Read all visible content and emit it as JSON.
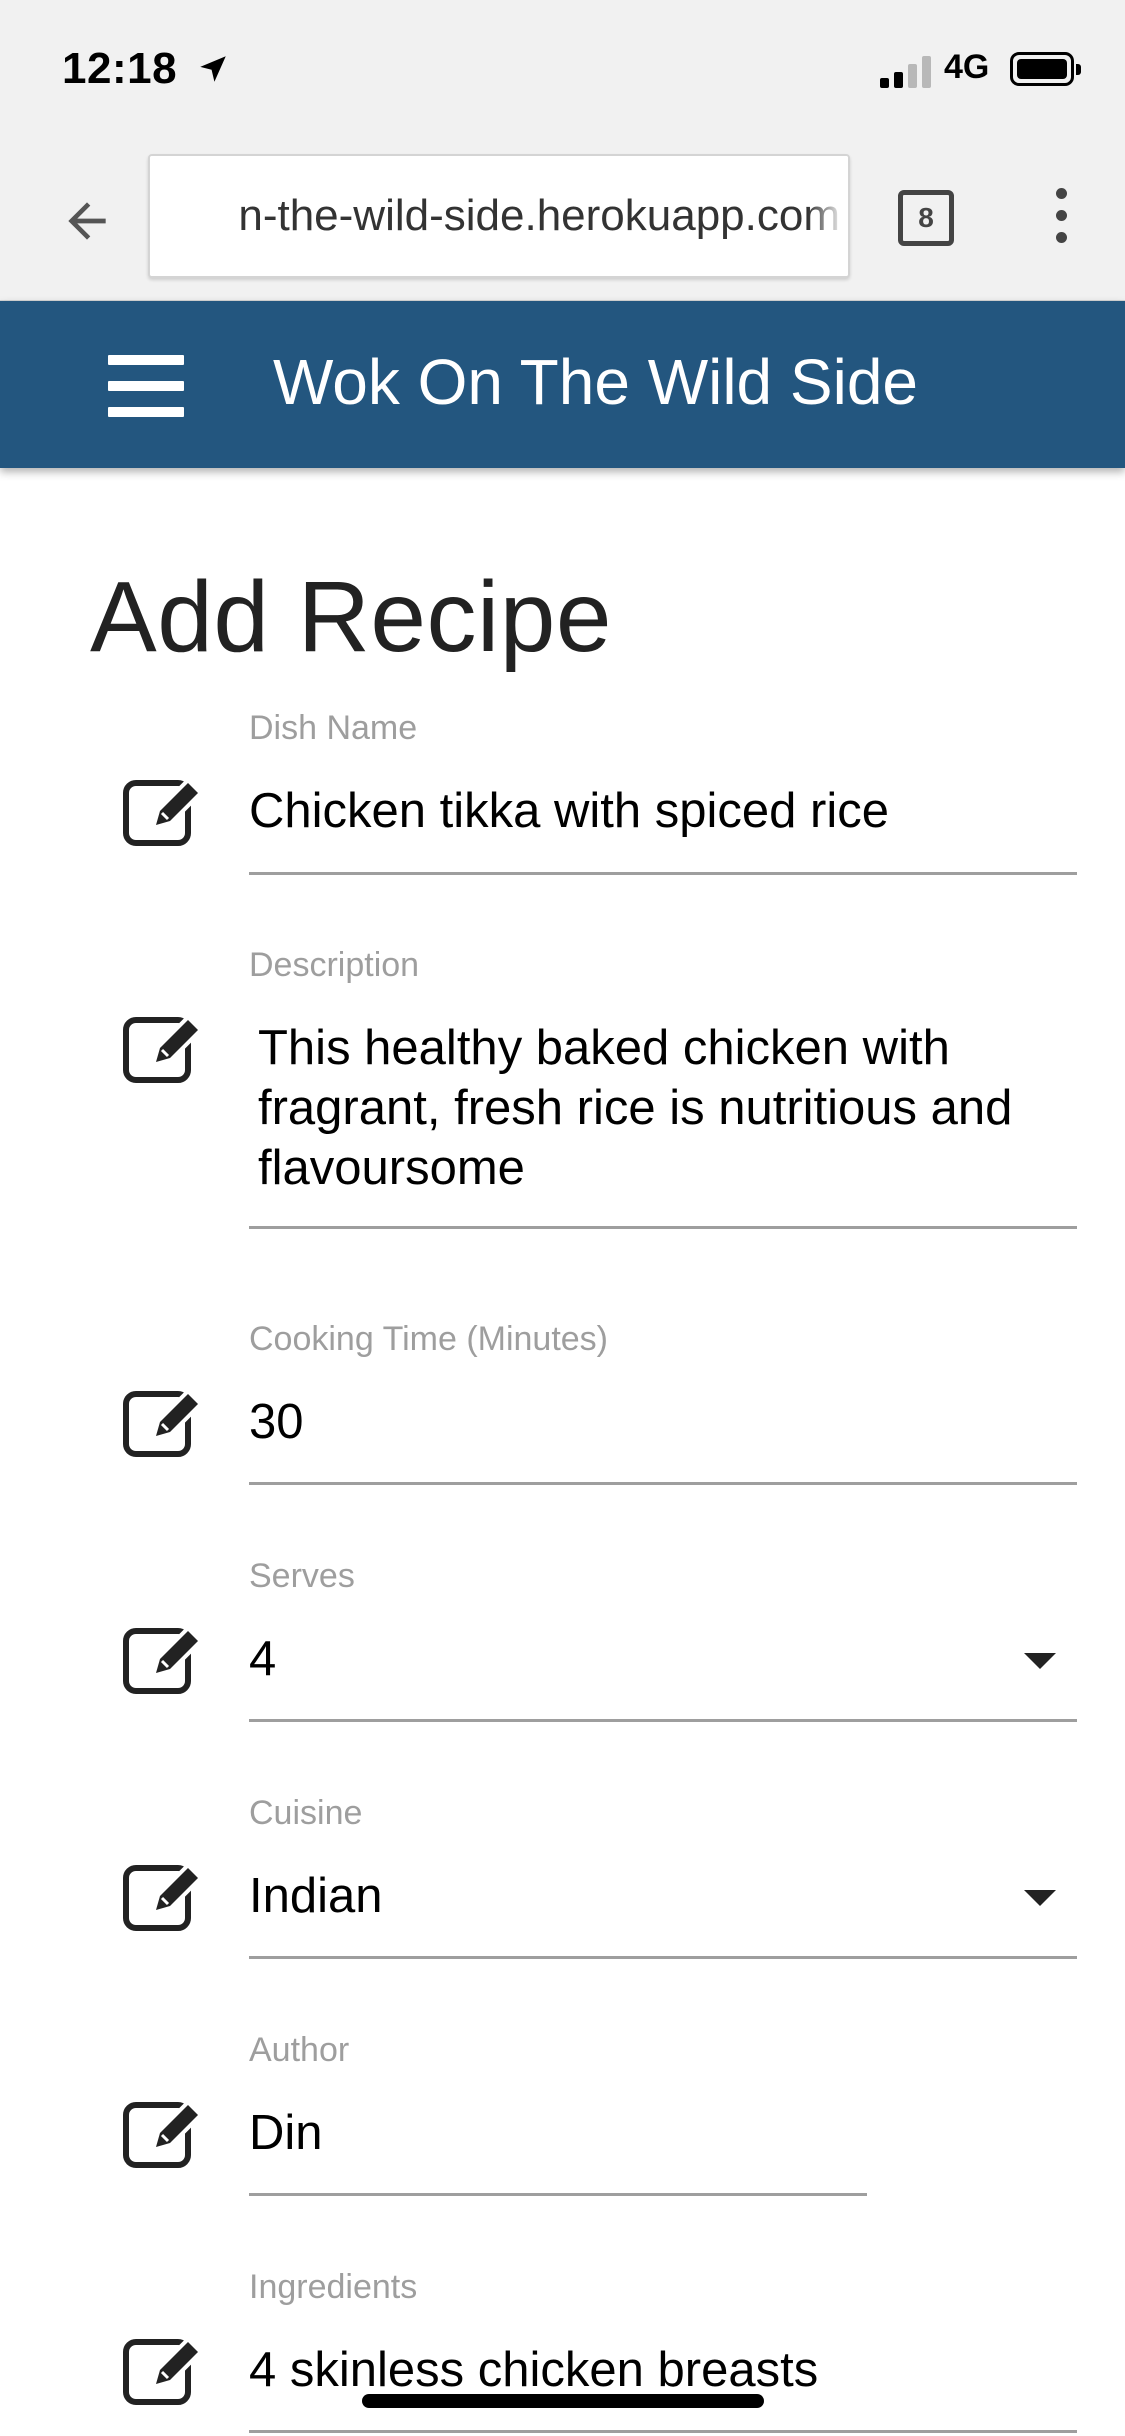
{
  "status_bar": {
    "time": "12:18",
    "network": "4G"
  },
  "browser": {
    "url": "n-the-wild-side.herokuapp.com",
    "tab_count": "8"
  },
  "nav": {
    "title": "Wok On The Wild Side"
  },
  "page": {
    "title": "Add Recipe"
  },
  "form": {
    "dish_name": {
      "label": "Dish Name",
      "value": "Chicken tikka with spiced rice"
    },
    "description": {
      "label": "Description",
      "value": "This healthy baked chicken with fragrant, fresh rice is nutritious and flavoursome"
    },
    "cooking_time": {
      "label": "Cooking Time (Minutes)",
      "value": "30"
    },
    "serves": {
      "label": "Serves",
      "value": "4"
    },
    "cuisine": {
      "label": "Cuisine",
      "value": "Indian"
    },
    "author": {
      "label": "Author",
      "value": "Din"
    },
    "ingredients": {
      "label": "Ingredients",
      "value": "4 skinless chicken breasts"
    }
  },
  "icons": {
    "back": "arrow-left-icon",
    "location": "location-arrow-icon",
    "menu": "hamburger-menu-icon",
    "field": "edit-icon",
    "dropdown": "caret-down-icon",
    "overflow": "more-vert-icon"
  },
  "colors": {
    "nav_bg": "#23567f",
    "nav_text": "#ffffff",
    "label": "#9e9e9e",
    "underline": "#9e9e9e"
  }
}
